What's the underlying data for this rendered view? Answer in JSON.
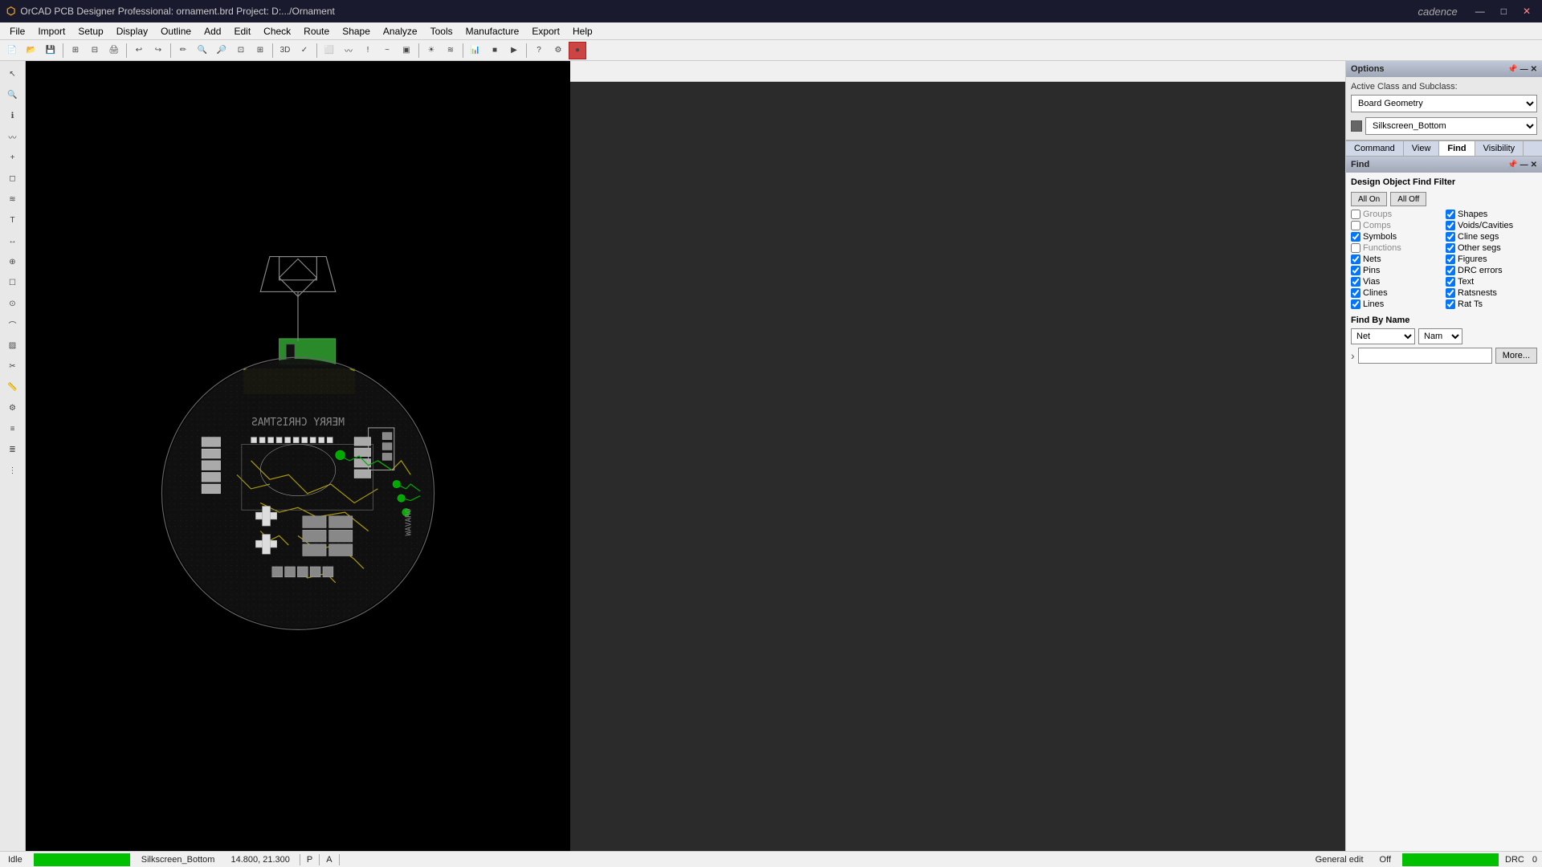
{
  "titlebar": {
    "title": "OrCAD PCB Designer Professional: ornament.brd  Project: D:.../Ornament",
    "logo": "cadence",
    "btns": [
      "—",
      "□",
      "✕"
    ]
  },
  "menubar": {
    "items": [
      "File",
      "Import",
      "Setup",
      "Display",
      "Outline",
      "Add",
      "Edit",
      "Check",
      "Route",
      "Shape",
      "Analyze",
      "Tools",
      "Manufacture",
      "Export",
      "Help"
    ]
  },
  "options_panel": {
    "title": "Options",
    "active_class_label": "Active Class and Subclass:",
    "class_value": "Board Geometry",
    "subclass_value": "Silkscreen_Bottom",
    "subclass_color": "#555"
  },
  "tabs": {
    "items": [
      "Command",
      "View",
      "Find",
      "Visibility"
    ],
    "active": "Find"
  },
  "find_panel": {
    "title": "Find",
    "filter_title": "Design Object Find Filter",
    "all_on_label": "All On",
    "all_off_label": "All Off",
    "filters": [
      {
        "label": "Groups",
        "checked": false,
        "col": 1
      },
      {
        "label": "Shapes",
        "checked": true,
        "col": 2
      },
      {
        "label": "Comps",
        "checked": false,
        "col": 1,
        "gray": true
      },
      {
        "label": "Voids/Cavities",
        "checked": true,
        "col": 2
      },
      {
        "label": "Symbols",
        "checked": true,
        "col": 1
      },
      {
        "label": "Cline segs",
        "checked": true,
        "col": 2
      },
      {
        "label": "Functions",
        "checked": false,
        "col": 1,
        "gray": true
      },
      {
        "label": "Other segs",
        "checked": true,
        "col": 2
      },
      {
        "label": "Nets",
        "checked": true,
        "col": 1
      },
      {
        "label": "Figures",
        "checked": true,
        "col": 2
      },
      {
        "label": "Pins",
        "checked": true,
        "col": 1
      },
      {
        "label": "DRC errors",
        "checked": true,
        "col": 2
      },
      {
        "label": "Vias",
        "checked": true,
        "col": 1
      },
      {
        "label": "Text",
        "checked": true,
        "col": 2
      },
      {
        "label": "Clines",
        "checked": true,
        "col": 1
      },
      {
        "label": "Ratsnests",
        "checked": true,
        "col": 2
      },
      {
        "label": "Lines",
        "checked": true,
        "col": 1
      },
      {
        "label": "Rat Ts",
        "checked": true,
        "col": 2
      }
    ],
    "find_by_name": {
      "title": "Find By Name",
      "type_value": "Net",
      "match_value": "Nam",
      "search_value": "",
      "more_btn": "More..."
    }
  },
  "statusbar": {
    "idle": "Idle",
    "layer": "Silkscreen_Bottom",
    "coords": "14.800, 21.300",
    "p": "P",
    "a": "A",
    "mode": "General edit",
    "off": "Off",
    "drc_label": "DRC",
    "drc_value": "0"
  },
  "canvas": {
    "bg": "#000000"
  }
}
